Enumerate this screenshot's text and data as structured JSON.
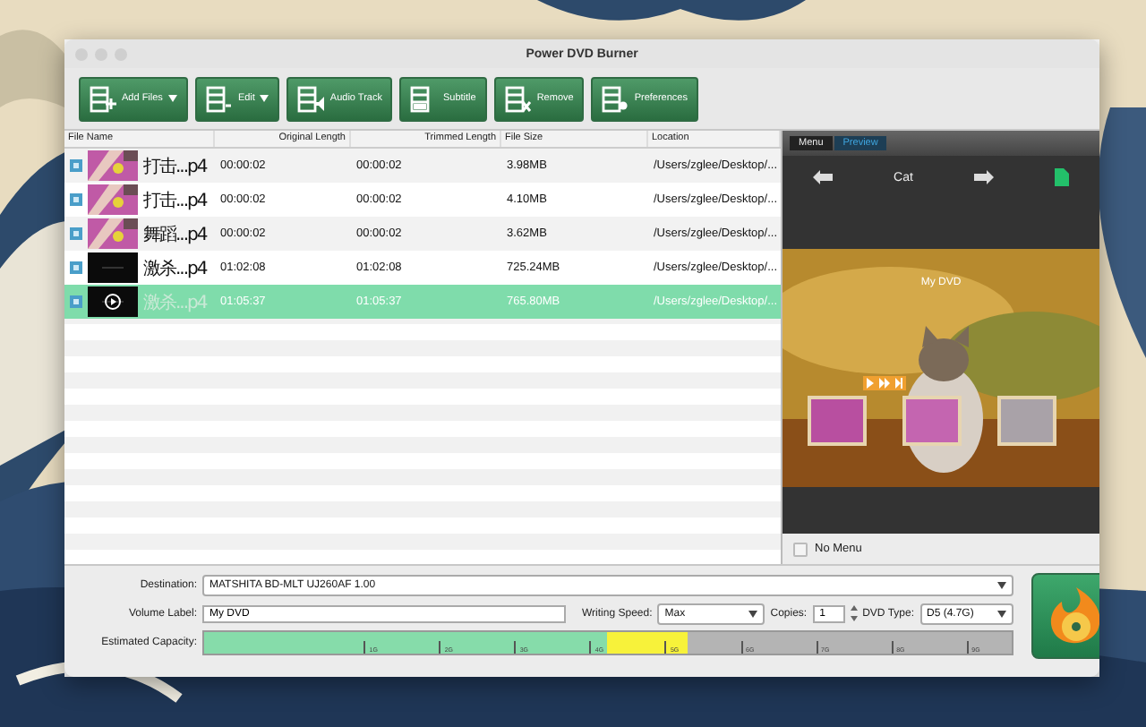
{
  "window": {
    "title": "Power DVD Burner"
  },
  "toolbar": [
    {
      "label": "Add Files",
      "kind": "add",
      "dropdown": true
    },
    {
      "label": "Edit",
      "kind": "edit",
      "dropdown": true
    },
    {
      "label": "Audio Track",
      "kind": "audio",
      "dropdown": false
    },
    {
      "label": "Subtitle",
      "kind": "subtitle",
      "dropdown": false
    },
    {
      "label": "Remove",
      "kind": "remove",
      "dropdown": false
    },
    {
      "label": "Preferences",
      "kind": "prefs",
      "dropdown": false
    }
  ],
  "table": {
    "columns": [
      "File Name",
      "Original Length",
      "Trimmed Length",
      "File Size",
      "Location"
    ],
    "rows": [
      {
        "name": "打击...p4",
        "kind": "pink",
        "original": "00:00:02",
        "trimmed": "00:00:02",
        "size": "3.98MB",
        "location": "/Users/zglee/Desktop/...",
        "selected": false
      },
      {
        "name": "打击...p4",
        "kind": "pink",
        "original": "00:00:02",
        "trimmed": "00:00:02",
        "size": "4.10MB",
        "location": "/Users/zglee/Desktop/...",
        "selected": false
      },
      {
        "name": "舞蹈...p4",
        "kind": "pink",
        "original": "00:00:02",
        "trimmed": "00:00:02",
        "size": "3.62MB",
        "location": "/Users/zglee/Desktop/...",
        "selected": false
      },
      {
        "name": "激杀...p4",
        "kind": "dark",
        "original": "01:02:08",
        "trimmed": "01:02:08",
        "size": "725.24MB",
        "location": "/Users/zglee/Desktop/...",
        "selected": false
      },
      {
        "name": "激杀...p4",
        "kind": "play",
        "original": "01:05:37",
        "trimmed": "01:05:37",
        "size": "765.80MB",
        "location": "/Users/zglee/Desktop/...",
        "selected": true
      }
    ]
  },
  "preview": {
    "tabs": [
      {
        "label": "Menu",
        "selected": false
      },
      {
        "label": "Preview",
        "selected": true
      }
    ],
    "template": "Cat",
    "disc_title": "My DVD",
    "no_menu": {
      "label": "No Menu",
      "checked": false
    }
  },
  "settings": {
    "destination_label": "Destination:",
    "destination": "MATSHITA BD-MLT UJ260AF 1.00",
    "volume_label": "Volume Label:",
    "volume": "My DVD",
    "speed_label": "Writing Speed:",
    "speed": "Max",
    "copies_label": "Copies:",
    "copies": "1",
    "dvd_type_label": "DVD Type:",
    "dvd_type": "D5 (4.7G)",
    "capacity_label": "Estimated Capacity:",
    "capacity": {
      "level": 0.5
    },
    "ticks": [
      "1G",
      "2G",
      "3G",
      "4G",
      "5G",
      "6G",
      "7G",
      "8G",
      "9G"
    ]
  }
}
